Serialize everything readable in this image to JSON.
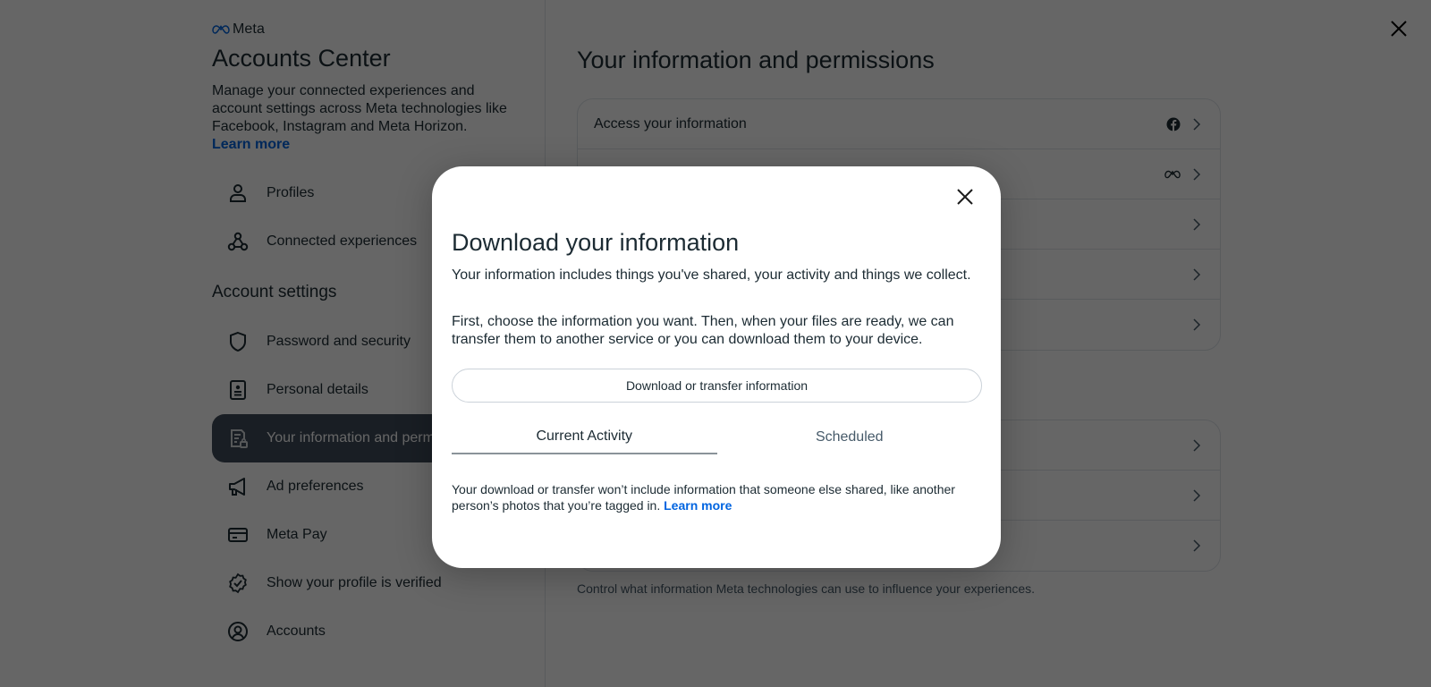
{
  "brand": {
    "logo_text": "Meta",
    "accent_color": "#0064e0"
  },
  "left": {
    "title": "Accounts Center",
    "description": "Manage your connected experiences and account settings across Meta technologies like Facebook, Instagram and Meta Horizon.",
    "learn_more": "Learn more",
    "top_items": [
      {
        "label": "Profiles",
        "icon": "person-icon"
      },
      {
        "label": "Connected experiences",
        "icon": "connected-nodes-icon"
      }
    ],
    "section_heading": "Account settings",
    "settings_items": [
      {
        "label": "Password and security",
        "icon": "shield-icon"
      },
      {
        "label": "Personal details",
        "icon": "id-card-icon"
      },
      {
        "label": "Your information and permissions",
        "icon": "document-lock-icon",
        "active": true
      },
      {
        "label": "Ad preferences",
        "icon": "megaphone-icon"
      },
      {
        "label": "Meta Pay",
        "icon": "credit-card-icon"
      },
      {
        "label": "Show your profile is verified",
        "icon": "verified-badge-icon"
      },
      {
        "label": "Accounts",
        "icon": "account-circle-icon"
      }
    ]
  },
  "right": {
    "title": "Your information and permissions",
    "card1_rows": [
      {
        "label": "Access your information",
        "trail_icon": "facebook-icon"
      },
      {
        "label": "",
        "trail_icon": "meta-icon"
      },
      {
        "label": "",
        "trail_icon": ""
      },
      {
        "label": "",
        "trail_icon": ""
      },
      {
        "label": "",
        "trail_icon": ""
      }
    ],
    "card2_rows": [
      {
        "label": ""
      },
      {
        "label": ""
      },
      {
        "label": ""
      }
    ],
    "footer_text": "Control what information Meta technologies can use to influence your experiences."
  },
  "modal": {
    "title": "Download your information",
    "paragraph1": "Your information includes things you've shared, your activity and things we collect.",
    "paragraph2": "First, choose the information you want. Then, when your files are ready, we can transfer them to another service or you can download them to your device.",
    "primary_button": "Download or transfer information",
    "tabs": [
      {
        "label": "Current Activity",
        "active": true
      },
      {
        "label": "Scheduled",
        "active": false
      }
    ],
    "note": "Your download or transfer won’t include information that someone else shared, like another person’s photos that you’re tagged in.",
    "note_link": "Learn more"
  }
}
